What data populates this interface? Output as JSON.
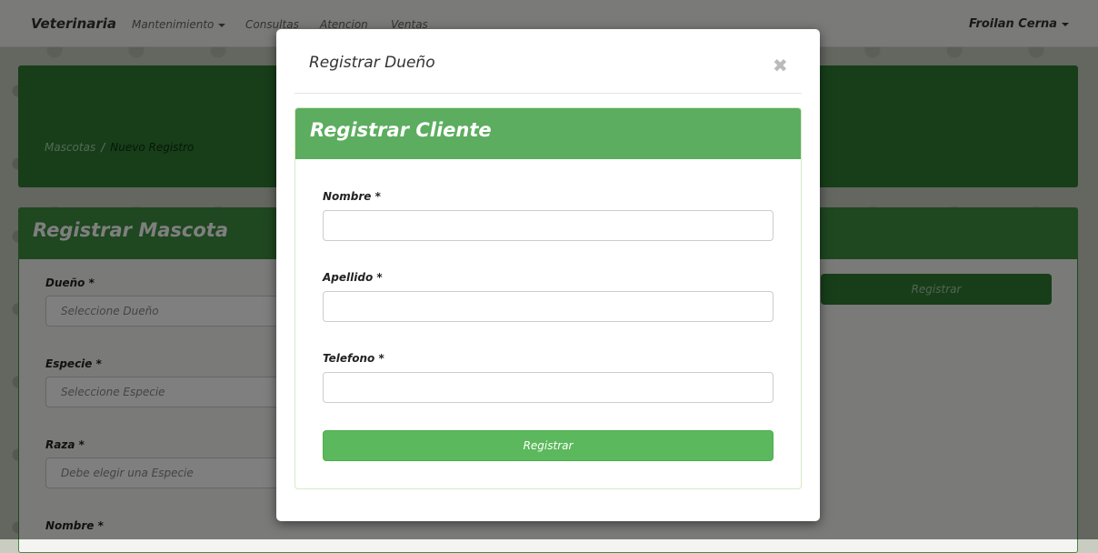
{
  "navbar": {
    "brand": "Veterinaria",
    "items": [
      "Mantenimiento",
      "Consultas",
      "Atencion",
      "Ventas"
    ],
    "user": "Froilan Cerna"
  },
  "breadcrumb": {
    "link": "Mascotas",
    "separator": "/",
    "current": "Nuevo Registro"
  },
  "pet_form": {
    "title": "Registrar Mascota",
    "fields": [
      {
        "label": "Dueño *",
        "placeholder": "Seleccione Dueño"
      },
      {
        "label": "Especie *",
        "placeholder": "Seleccione Especie"
      },
      {
        "label": "Raza *",
        "placeholder": "Debe elegir una Especie"
      },
      {
        "label": "Nombre *"
      }
    ],
    "register_button": "Registrar"
  },
  "modal": {
    "title": "Registrar Dueño",
    "close_symbol": "✖",
    "card_title": "Registrar Cliente",
    "fields": [
      {
        "label": "Nombre *"
      },
      {
        "label": "Apellido *"
      },
      {
        "label": "Telefono *"
      }
    ],
    "submit": "Registrar"
  },
  "colors": {
    "brand_green": "#2f7d32",
    "panel_green": "#3e8e41",
    "card_green": "#5cad5f",
    "button_green": "#5cb85c"
  }
}
